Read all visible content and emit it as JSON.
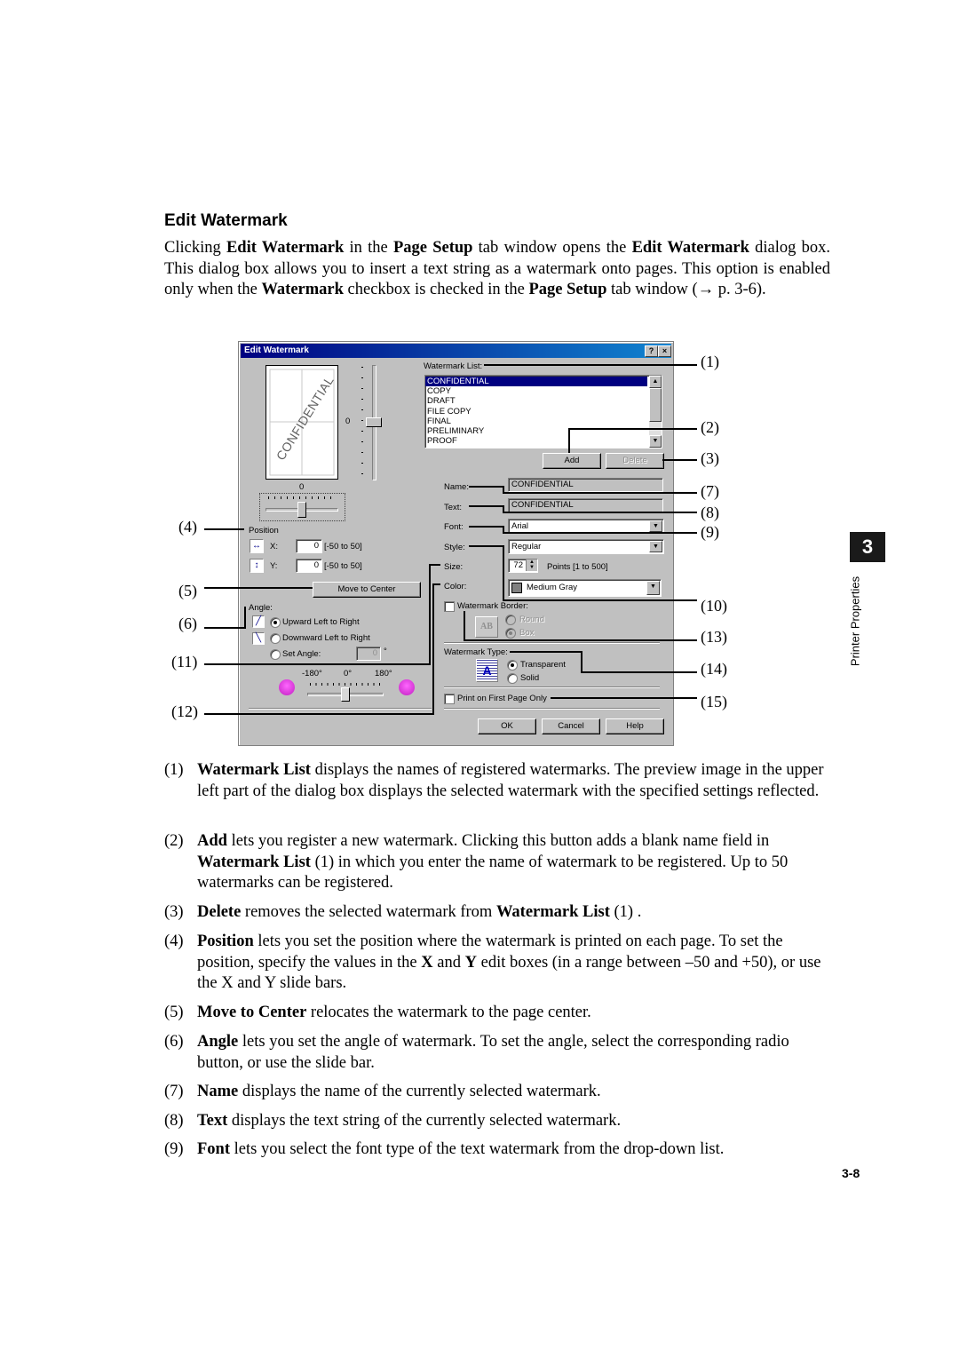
{
  "section_heading": "Edit Watermark",
  "intro": {
    "p1": "Clicking ",
    "b1": "Edit Watermark",
    "p2": " in the ",
    "b2": "Page Setup",
    "p3": " tab window opens the ",
    "b3": "Edit Watermark",
    "p4": " dialog box. This dialog box allows you to insert a text string as a watermark onto pages. This option is enabled only when the ",
    "b4": "Watermark",
    "p5": " checkbox is checked in the ",
    "b5": "Page Setup",
    "p6": " tab window (→ p. 3-6)."
  },
  "dialog": {
    "title": "Edit Watermark",
    "help_btn": "?",
    "close_btn": "×",
    "preview": {
      "watermark_text": "CONFIDENTIAL",
      "y_slider_value": "0",
      "x_slider_value": "0"
    },
    "watermark_list": {
      "label": "Watermark List:",
      "items": [
        "CONFIDENTIAL",
        "COPY",
        "DRAFT",
        "FILE COPY",
        "FINAL",
        "PRELIMINARY",
        "PROOF"
      ],
      "selected": "CONFIDENTIAL"
    },
    "add_button": "Add",
    "delete_button": "Delete",
    "name": {
      "label": "Name:",
      "value": "CONFIDENTIAL"
    },
    "text": {
      "label": "Text:",
      "value": "CONFIDENTIAL"
    },
    "font": {
      "label": "Font:",
      "value": "Arial"
    },
    "style": {
      "label": "Style:",
      "value": "Regular"
    },
    "size": {
      "label": "Size:",
      "value": "72",
      "range": "Points [1 to 500]"
    },
    "color": {
      "label": "Color:",
      "value": "Medium Gray",
      "swatch": "#808080"
    },
    "position": {
      "label": "Position",
      "x_label": "X:",
      "x_value": "0",
      "x_range": "[-50 to 50]",
      "y_label": "Y:",
      "y_value": "0",
      "y_range": "[-50 to 50]"
    },
    "move_to_center_button": "Move to Center",
    "angle": {
      "label": "Angle:",
      "options": [
        "Upward Left to Right",
        "Downward Left to Right",
        "Set Angle:"
      ],
      "selected": "Upward Left to Right",
      "set_angle_value": "0",
      "degree_symbol": "°",
      "slider_ticks": [
        "-180°",
        "0°",
        "180°"
      ]
    },
    "watermark_border": {
      "label": "Watermark Border:",
      "checked": false,
      "options": [
        "Round",
        "Box"
      ],
      "selected": "Box",
      "icon_text": "AB"
    },
    "watermark_type": {
      "label": "Watermark Type:",
      "options": [
        "Transparent",
        "Solid"
      ],
      "selected": "Transparent"
    },
    "print_first_page_only": {
      "label": "Print on First Page Only",
      "checked": false
    },
    "ok_button": "OK",
    "cancel_button": "Cancel",
    "help_button": "Help"
  },
  "callouts": {
    "c1": "(1)",
    "c2": "(2)",
    "c3": "(3)",
    "c4": "(4)",
    "c5": "(5)",
    "c6": "(6)",
    "c7": "(7)",
    "c8": "(8)",
    "c9": "(9)",
    "c10": "(10)",
    "c11": "(11)",
    "c12": "(12)",
    "c13": "(13)",
    "c14": "(14)",
    "c15": "(15)"
  },
  "descriptions": [
    {
      "num": "(1)",
      "bold": "Watermark List",
      "text": " displays the names of registered watermarks. The preview image in the upper left part of the dialog box displays the selected watermark with the specified settings reflected."
    },
    {
      "num": "(2)",
      "bold": "Add",
      "text": " lets you register a new watermark. Clicking this button adds a blank name field in ",
      "bold2": "Watermark List",
      "text2": " (1) in which you enter the name of watermark to be registered. Up to 50 watermarks can be registered."
    },
    {
      "num": "(3)",
      "bold": "Delete",
      "text": " removes the selected watermark from ",
      "bold2": "Watermark List",
      "text2": " (1) ."
    },
    {
      "num": "(4)",
      "bold": "Position",
      "text": " lets you set the position where the watermark is printed on each page. To set the position, specify the values in the ",
      "bold2": "X",
      "text2": " and ",
      "bold3": "Y",
      "text3": " edit boxes (in a range between –50 and +50), or use the X and Y slide bars."
    },
    {
      "num": "(5)",
      "bold": "Move to Center",
      "text": " relocates the watermark to the page center."
    },
    {
      "num": "(6)",
      "bold": "Angle",
      "text": " lets you set the angle of watermark. To set the angle, select the corresponding radio button, or use the slide bar."
    },
    {
      "num": "(7)",
      "bold": "Name",
      "text": " displays the name of the currently selected watermark."
    },
    {
      "num": "(8)",
      "bold": "Text",
      "text": " displays the text string of the currently selected watermark."
    },
    {
      "num": "(9)",
      "bold": "Font",
      "text": " lets you select the font type of the text watermark from the drop-down list."
    }
  ],
  "chapter_tab": "3",
  "side_label": "Printer Properties",
  "page_number": "3-8"
}
